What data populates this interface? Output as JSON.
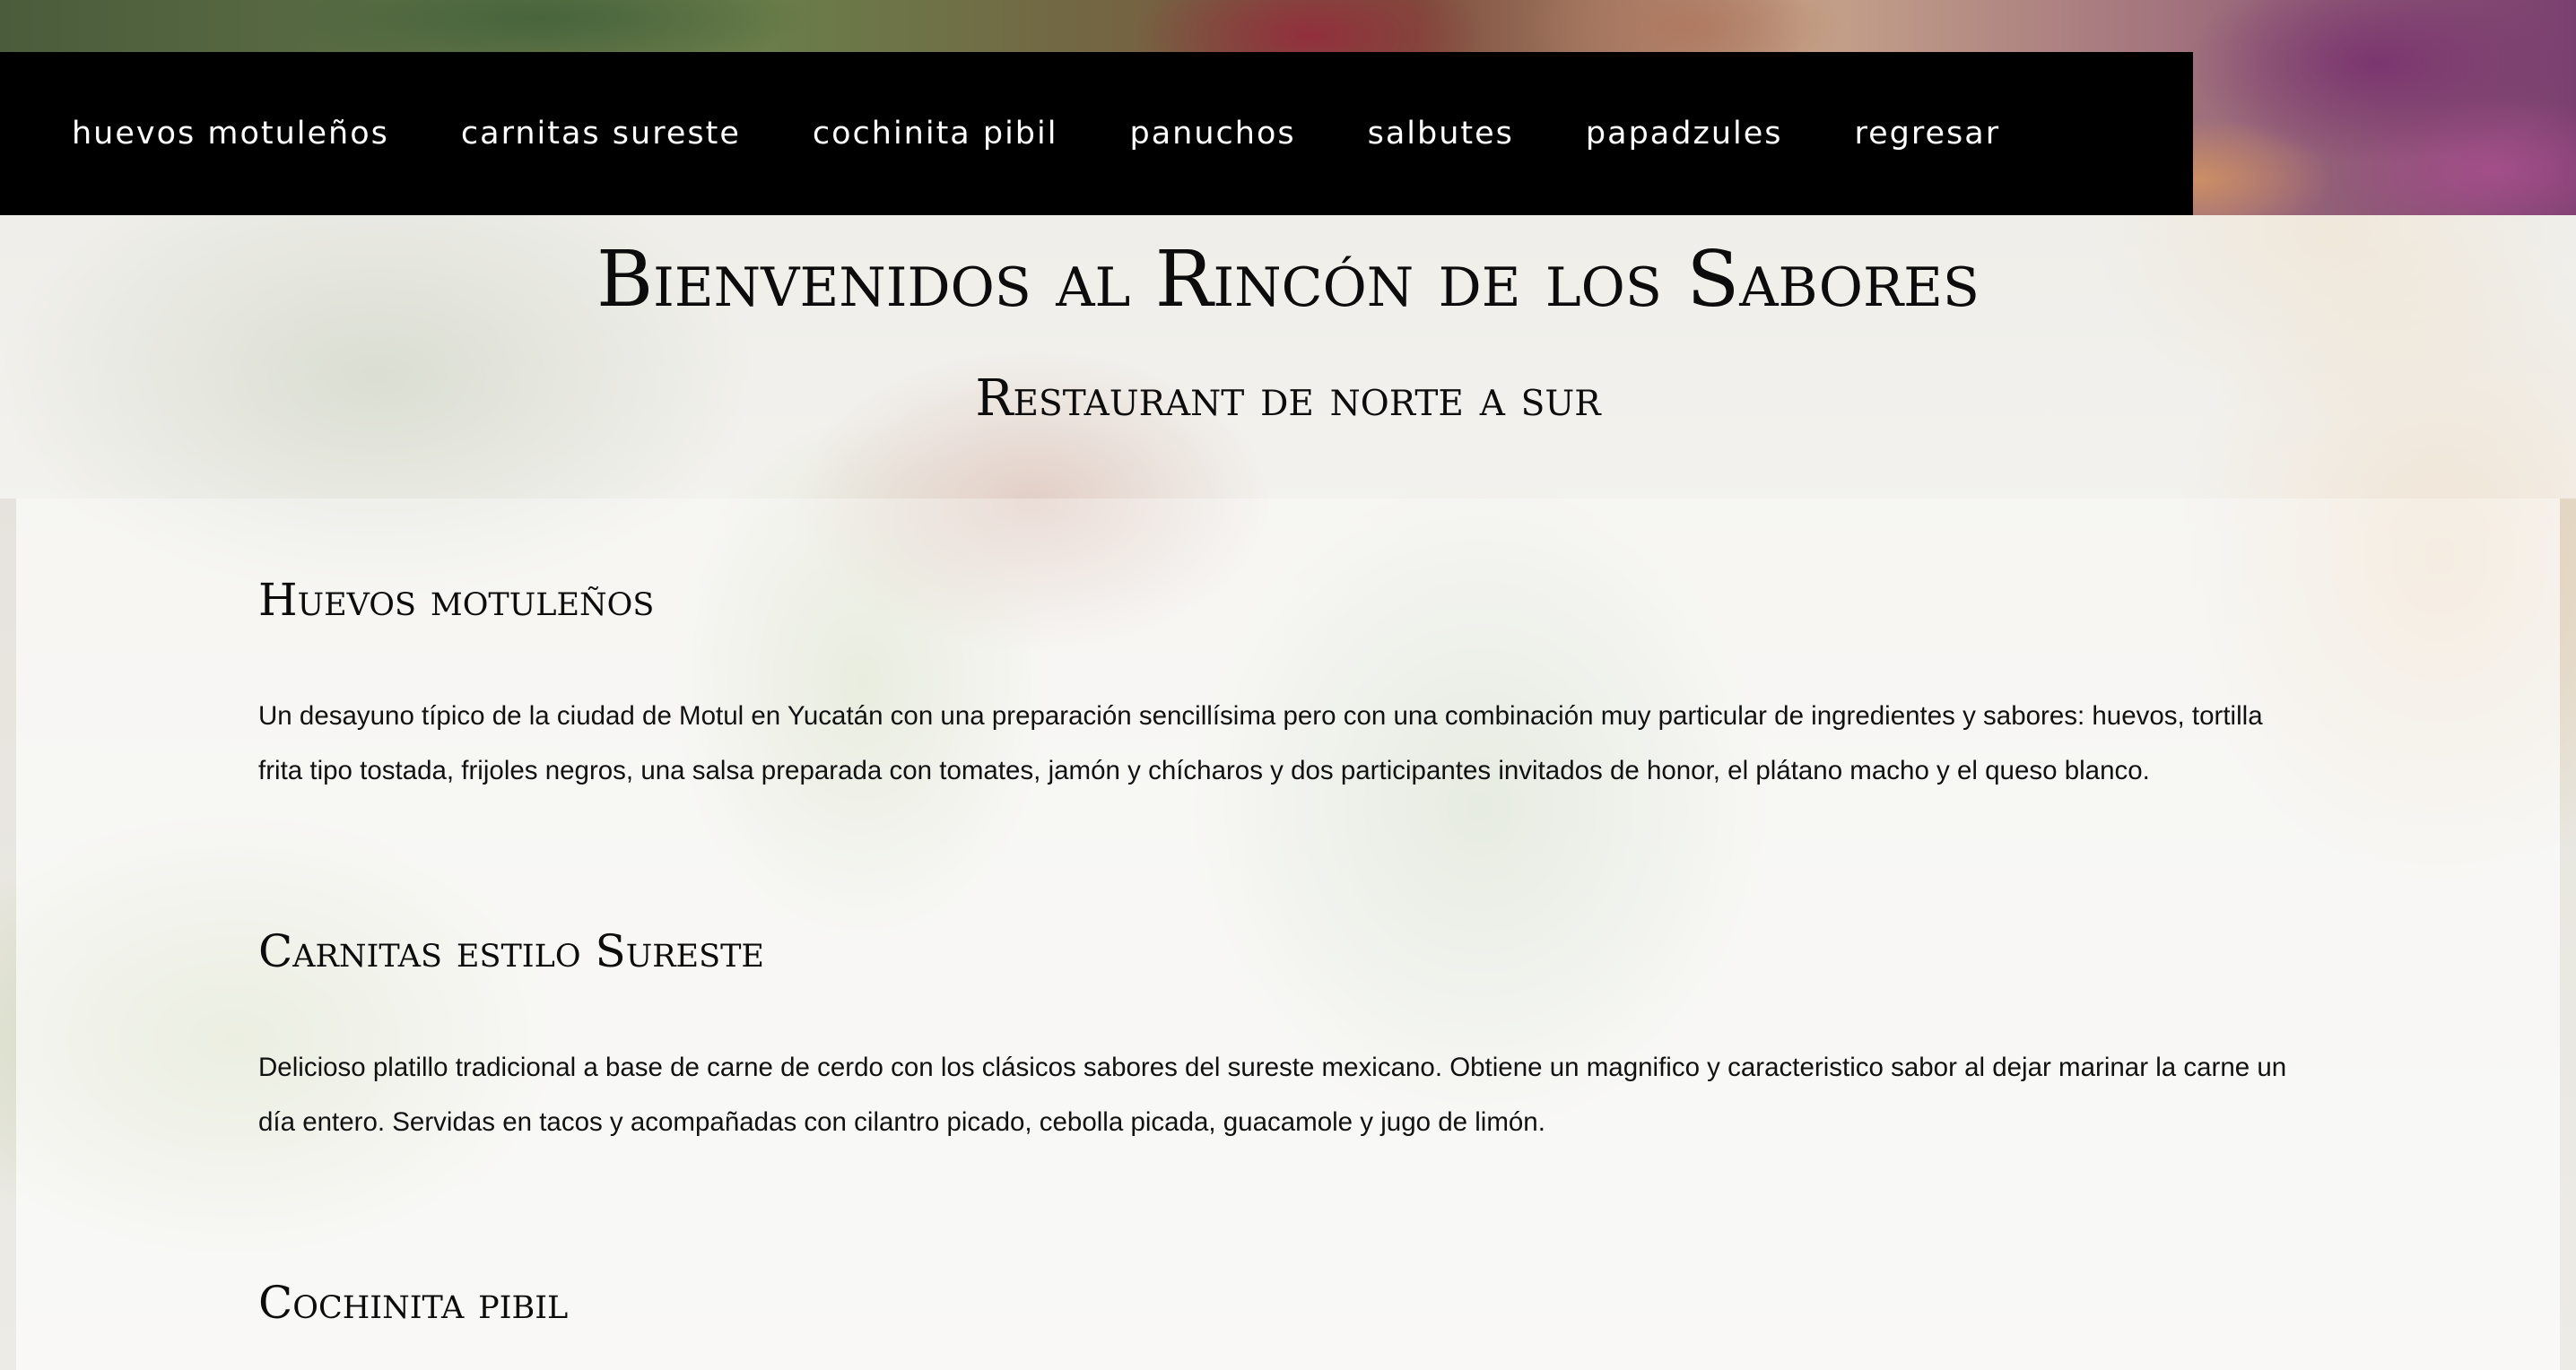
{
  "nav": {
    "items": [
      {
        "label": "huevos motuleños"
      },
      {
        "label": "carnitas sureste"
      },
      {
        "label": "cochinita pibil"
      },
      {
        "label": "panuchos"
      },
      {
        "label": "salbutes"
      },
      {
        "label": "papadzules"
      },
      {
        "label": "regresar"
      }
    ]
  },
  "header": {
    "title": "Bienvenidos al Rincón de los Sabores",
    "subtitle": "Restaurant de norte a sur"
  },
  "sections": [
    {
      "title": "Huevos motuleños",
      "text": "Un desayuno típico de la ciudad de Motul en Yucatán con una preparación sencillísima pero con una combinación muy particular de ingredientes y sabores: huevos, tortilla frita tipo tostada, frijoles negros, una salsa preparada con tomates, jamón y chícharos y dos participantes invitados de honor, el plátano macho y el queso blanco."
    },
    {
      "title": "Carnitas estilo Sureste",
      "text": "Delicioso platillo tradicional a base de carne de cerdo con los clásicos sabores del sureste mexicano. Obtiene un magnifico y caracteristico sabor al dejar marinar la carne un día entero. Servidas en tacos y acompañadas con cilantro picado, cebolla picada, guacamole y jugo de limón."
    },
    {
      "title": "Cochinita pibil"
    }
  ]
}
